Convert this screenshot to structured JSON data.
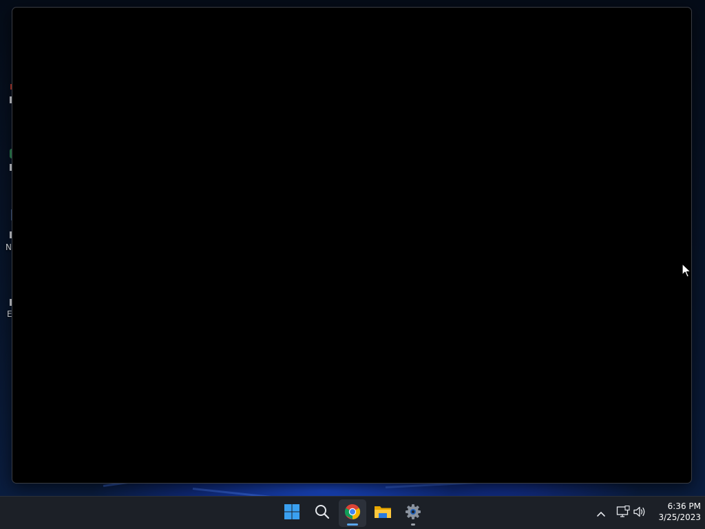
{
  "desktop": {
    "icons": [
      {
        "name": "desktop-icon-my-computer",
        "label": "My"
      },
      {
        "name": "desktop-icon-2",
        "label": ""
      },
      {
        "name": "desktop-icon-3",
        "label": ""
      },
      {
        "name": "desktop-icon-4",
        "label": "N"
      },
      {
        "name": "desktop-icon-5",
        "label": "E"
      }
    ]
  },
  "window": {
    "title": ""
  },
  "taskbar": {
    "pinned": [
      {
        "name": "start-button",
        "icon": "windows-logo-icon",
        "active": false
      },
      {
        "name": "search-button",
        "icon": "search-icon",
        "active": false
      },
      {
        "name": "chrome-button",
        "icon": "chrome-icon",
        "active": true,
        "indicator": "#5aa8f0"
      },
      {
        "name": "file-explorer-button",
        "icon": "folder-icon",
        "active": false
      },
      {
        "name": "settings-button",
        "icon": "gear-icon",
        "active": false,
        "indicator": "#9aa0a8"
      }
    ],
    "tray": {
      "show_hidden_icon": "chevron-up-icon",
      "network_icon": "network-icon",
      "volume_icon": "volume-icon"
    },
    "clock": {
      "time": "6:36 PM",
      "date": "3/25/2023"
    }
  },
  "colors": {
    "accent": "#5aa8f0",
    "taskbar": "#1c2027",
    "window_bg": "#000000"
  }
}
